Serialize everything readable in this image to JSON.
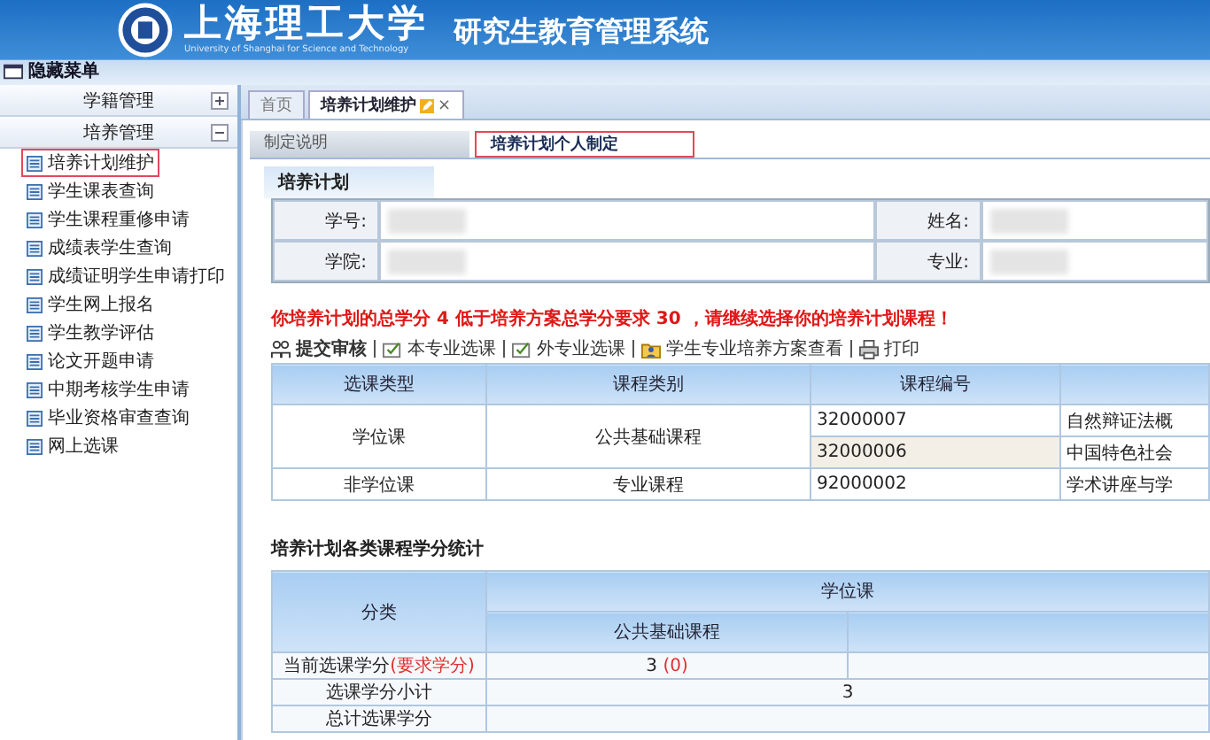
{
  "header": {
    "school_name": "上海理工大学",
    "school_name_en": "University of Shanghai for Science and Technology",
    "system_title": "研究生教育管理系统",
    "hide_menu": "隐藏菜单"
  },
  "sidebar": {
    "groups": [
      {
        "label": "学籍管理",
        "expanded": false
      },
      {
        "label": "培养管理",
        "expanded": true,
        "items": [
          {
            "label": "培养计划维护",
            "selected": true
          },
          {
            "label": "学生课表查询",
            "selected": false
          },
          {
            "label": "学生课程重修申请",
            "selected": false
          },
          {
            "label": "成绩表学生查询",
            "selected": false
          },
          {
            "label": "成绩证明学生申请打印",
            "selected": false
          },
          {
            "label": "学生网上报名",
            "selected": false
          },
          {
            "label": "学生教学评估",
            "selected": false
          },
          {
            "label": "论文开题申请",
            "selected": false
          },
          {
            "label": "中期考核学生申请",
            "selected": false
          },
          {
            "label": "毕业资格审查查询",
            "selected": false
          },
          {
            "label": "网上选课",
            "selected": false
          }
        ]
      }
    ]
  },
  "page_tabs": [
    {
      "label": "首页",
      "selected": false
    },
    {
      "label": "培养计划维护",
      "selected": true,
      "close": "×"
    }
  ],
  "sub_tabs": [
    {
      "label": "制定说明",
      "selected": false
    },
    {
      "label": "培养计划个人制定",
      "selected": true
    }
  ],
  "plan": {
    "title": "培养计划",
    "fields": [
      {
        "label": "学号:"
      },
      {
        "label": "姓名:"
      },
      {
        "label": "学院:"
      },
      {
        "label": "专业:"
      }
    ]
  },
  "warning": "你培养计划的总学分 4 低于培养方案总学分要求 30 ，请继续选择你的培养计划课程！",
  "toolbar": [
    {
      "label": "提交审核",
      "kind": "submit"
    },
    {
      "label": "本专业选课",
      "kind": "check"
    },
    {
      "label": "外专业选课",
      "kind": "check"
    },
    {
      "label": "学生专业培养方案查看",
      "kind": "folder"
    },
    {
      "label": "打印",
      "kind": "print"
    }
  ],
  "courses": {
    "columns": [
      "选课类型",
      "课程类别",
      "课程编号"
    ],
    "groups": [
      {
        "type": "学位课",
        "category": "公共基础课程",
        "rows": [
          {
            "code": "32000007",
            "column_4": "自然辩证法概",
            "selected": false
          },
          {
            "code": "32000006",
            "column_4": "中国特色社会",
            "selected": true
          }
        ]
      },
      {
        "type": "非学位课",
        "category": "专业课程",
        "rows": [
          {
            "code": "92000002",
            "column_4": "学术讲座与学",
            "selected": false
          }
        ]
      }
    ]
  },
  "stats": {
    "title": "培养计划各类课程学分统计",
    "category_header": "分类",
    "group_header": "学位课",
    "sub_header": "公共基础课程",
    "current": {
      "label": "当前选课学分",
      "label_note": "(要求学分)",
      "value": "3",
      "value_note": "(0)"
    },
    "subtotal": {
      "label": "选课学分小计",
      "value": "3"
    },
    "total": {
      "label": "总计选课学分"
    }
  }
}
